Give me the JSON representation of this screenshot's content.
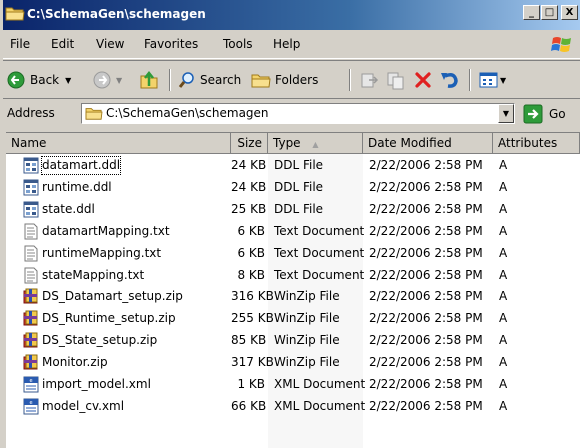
{
  "window": {
    "title": "C:\\SchemaGen\\schemagen",
    "minimize": "_",
    "maximize": "□",
    "close": "X"
  },
  "menu": [
    {
      "label": "File"
    },
    {
      "label": "Edit"
    },
    {
      "label": "View"
    },
    {
      "label": "Favorites"
    },
    {
      "label": "Tools"
    },
    {
      "label": "Help"
    }
  ],
  "toolbar": {
    "back_label": "Back",
    "search_label": "Search",
    "folders_label": "Folders"
  },
  "address": {
    "label": "Address",
    "value": "C:\\SchemaGen\\schemagen",
    "go_label": "Go"
  },
  "columns": {
    "name": "Name",
    "size": "Size",
    "type": "Type",
    "date": "Date Modified",
    "attributes": "Attributes"
  },
  "files": [
    {
      "name": "datamart.ddl",
      "size": "24 KB",
      "type": "DDL File",
      "date": "2/22/2006 2:58 PM",
      "attr": "A",
      "icon": "ddl-file-icon"
    },
    {
      "name": "runtime.ddl",
      "size": "24 KB",
      "type": "DDL File",
      "date": "2/22/2006 2:58 PM",
      "attr": "A",
      "icon": "ddl-file-icon"
    },
    {
      "name": "state.ddl",
      "size": "25 KB",
      "type": "DDL File",
      "date": "2/22/2006 2:58 PM",
      "attr": "A",
      "icon": "ddl-file-icon"
    },
    {
      "name": "datamartMapping.txt",
      "size": "6 KB",
      "type": "Text Document",
      "date": "2/22/2006 2:58 PM",
      "attr": "A",
      "icon": "text-file-icon"
    },
    {
      "name": "runtimeMapping.txt",
      "size": "6 KB",
      "type": "Text Document",
      "date": "2/22/2006 2:58 PM",
      "attr": "A",
      "icon": "text-file-icon"
    },
    {
      "name": "stateMapping.txt",
      "size": "8 KB",
      "type": "Text Document",
      "date": "2/22/2006 2:58 PM",
      "attr": "A",
      "icon": "text-file-icon"
    },
    {
      "name": "DS_Datamart_setup.zip",
      "size": "316 KB",
      "type": "WinZip File",
      "date": "2/22/2006 2:58 PM",
      "attr": "A",
      "icon": "winzip-file-icon"
    },
    {
      "name": "DS_Runtime_setup.zip",
      "size": "255 KB",
      "type": "WinZip File",
      "date": "2/22/2006 2:58 PM",
      "attr": "A",
      "icon": "winzip-file-icon"
    },
    {
      "name": "DS_State_setup.zip",
      "size": "85 KB",
      "type": "WinZip File",
      "date": "2/22/2006 2:58 PM",
      "attr": "A",
      "icon": "winzip-file-icon"
    },
    {
      "name": "Monitor.zip",
      "size": "317 KB",
      "type": "WinZip File",
      "date": "2/22/2006 2:58 PM",
      "attr": "A",
      "icon": "winzip-file-icon"
    },
    {
      "name": "import_model.xml",
      "size": "1 KB",
      "type": "XML Document",
      "date": "2/22/2006 2:58 PM",
      "attr": "A",
      "icon": "xml-file-icon"
    },
    {
      "name": "model_cv.xml",
      "size": "66 KB",
      "type": "XML Document",
      "date": "2/22/2006 2:58 PM",
      "attr": "A",
      "icon": "xml-file-icon"
    }
  ]
}
